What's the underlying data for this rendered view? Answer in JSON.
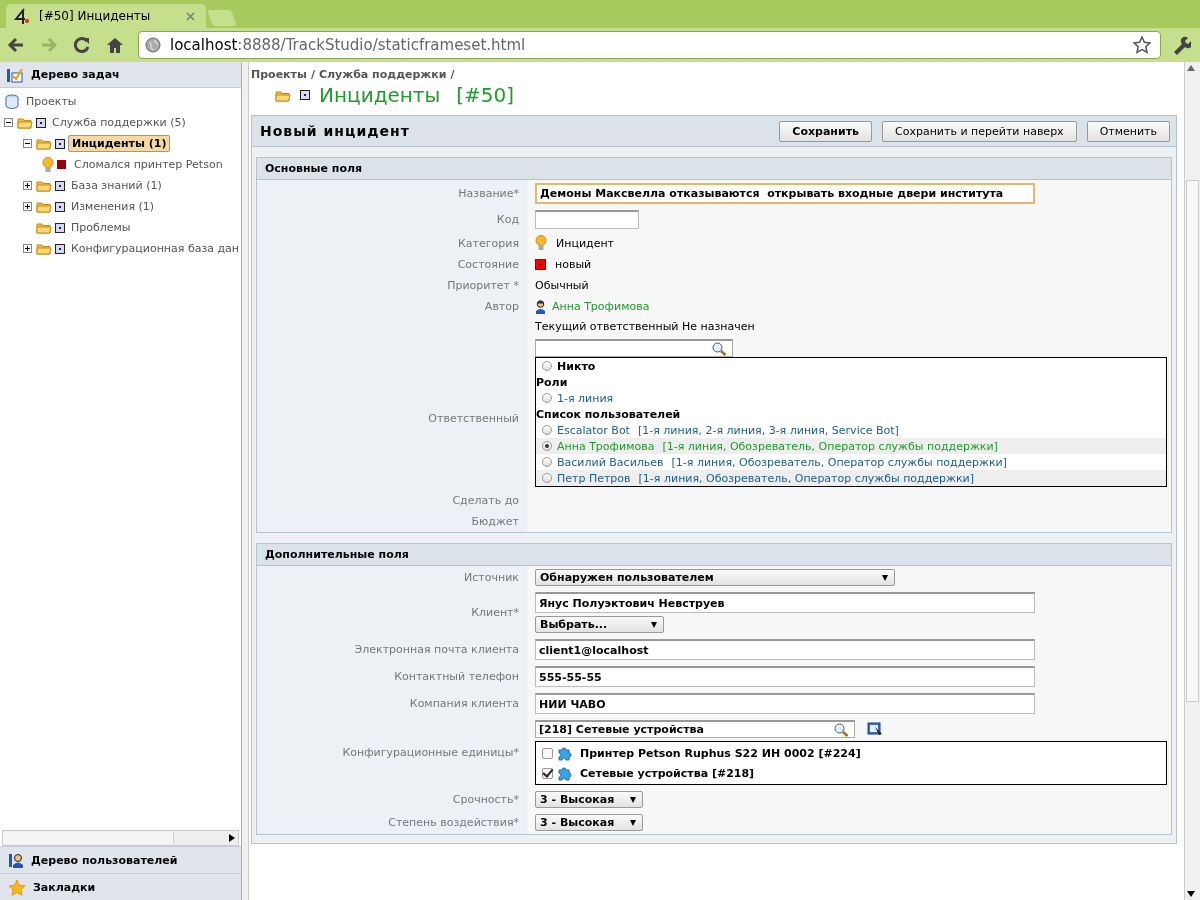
{
  "browser": {
    "tab_title": "[#50] Инциденты",
    "url_host": "localhost",
    "url_rest": ":8888/TrackStudio/staticframeset.html",
    "forward_disabled": true
  },
  "sidebar": {
    "title": "Дерево задач",
    "tree": [
      {
        "label": "Проекты",
        "kind": "projects",
        "selected": false,
        "children": [
          {
            "label": "Служба поддержки (5)",
            "kind": "folder",
            "expanded": true,
            "selected": false,
            "children": [
              {
                "label": "Инциденты (1)",
                "kind": "folder",
                "expanded": true,
                "selected": true,
                "children": [
                  {
                    "label": "Сломался принтер Petson",
                    "kind": "task",
                    "color": "#990000",
                    "selected": false
                  }
                ]
              },
              {
                "label": "База знаний (1)",
                "kind": "folder",
                "expanded": false,
                "selected": false
              },
              {
                "label": "Изменения (1)",
                "kind": "folder",
                "expanded": false,
                "selected": false
              },
              {
                "label": "Проблемы",
                "kind": "empty-folder",
                "selected": false
              },
              {
                "label": "Конфигурационная база дан",
                "kind": "folder",
                "expanded": false,
                "selected": false
              }
            ]
          }
        ]
      }
    ],
    "panels": [
      {
        "label": "Дерево пользователей",
        "kind": "users"
      },
      {
        "label": "Закладки",
        "kind": "bookmarks"
      }
    ]
  },
  "main": {
    "breadcrumbs": [
      {
        "label": "Проекты",
        "separator": "/"
      },
      {
        "label": "Служба поддержки",
        "separator": "/"
      }
    ],
    "title": "Инциденты",
    "number": "[#50]",
    "form": {
      "title": "Новый инцидент",
      "buttons": [
        "Сохранить",
        "Сохранить и перейти наверх",
        "Отменить"
      ],
      "sections": [
        {
          "title": "Основные поля",
          "rows": [
            {
              "label": "Название*",
              "kind": "input",
              "value": "Демоны Максвелла отказываются  открывать входные двери института",
              "focused": true
            },
            {
              "label": "Код",
              "kind": "short-input",
              "value": "",
              "focused": false
            },
            {
              "label": "Категория",
              "kind": "category",
              "value": "Инцидент"
            },
            {
              "label": "Состояние",
              "kind": "state",
              "value": "новый",
              "color": "#ff0000"
            },
            {
              "label": "Приоритет *",
              "kind": "text",
              "value": "Обычный"
            },
            {
              "label": "Автор",
              "kind": "person",
              "value": "Анна Трофимова"
            },
            {
              "label": "Ответственный",
              "kind": "assignee",
              "current": "Текущий ответственный Не назначен",
              "options": [
                {
                  "kind": "nobody",
                  "label": "Никто",
                  "selected": false
                },
                {
                  "kind": "heading",
                  "label": "Роли"
                },
                {
                  "kind": "role",
                  "label": "1-я линия",
                  "selected": false
                },
                {
                  "kind": "heading",
                  "label": "Список пользователей"
                },
                {
                  "kind": "user",
                  "label": "Escalator Bot",
                  "roles": "[1-я линия, 2-я линия, 3-я линия, Service Bot]",
                  "selected": false
                },
                {
                  "kind": "user",
                  "label": "Анна Трофимова",
                  "roles": "[1-я линия, Обозреватель, Оператор службы поддержки]",
                  "selected": true
                },
                {
                  "kind": "user",
                  "label": "Василий Васильев",
                  "roles": "[1-я линия, Обозреватель, Оператор службы поддержки]",
                  "selected": false
                },
                {
                  "kind": "user",
                  "label": "Петр Петров",
                  "roles": "[1-я линия, Обозреватель, Оператор службы поддержки]",
                  "selected": false
                }
              ]
            },
            {
              "label": "Сделать до",
              "kind": "empty"
            },
            {
              "label": "Бюджет",
              "kind": "empty"
            }
          ]
        },
        {
          "title": "Дополнительные поля",
          "rows": [
            {
              "label": "Источник",
              "kind": "select",
              "value": "Обнаружен пользователем"
            },
            {
              "label": "Клиент*",
              "kind": "client",
              "value": "Янус Полуэктович Невструев",
              "choose": "Выбрать..."
            },
            {
              "label": "Электронная почта клиента",
              "kind": "input",
              "value": "client1@localhost",
              "focused": false
            },
            {
              "label": "Контактный телефон",
              "kind": "input",
              "value": "555-55-55",
              "focused": false
            },
            {
              "label": "Компания клиента",
              "kind": "input",
              "value": "НИИ ЧАВО",
              "focused": false
            },
            {
              "label": "Конфигурационные единицы*",
              "kind": "units",
              "search": "[218] Сетевые устройства",
              "items": [
                {
                  "label": "Принтер Petson Ruphus S22 ИН 0002  [#224]",
                  "checked": false
                },
                {
                  "label": "Сетевые устройства  [#218]",
                  "checked": true
                }
              ]
            },
            {
              "label": "Срочность*",
              "kind": "small-select",
              "value": "3 - Высокая"
            },
            {
              "label": "Степень воздействия*",
              "kind": "small-select",
              "value": "3 - Высокая"
            }
          ]
        }
      ]
    }
  }
}
